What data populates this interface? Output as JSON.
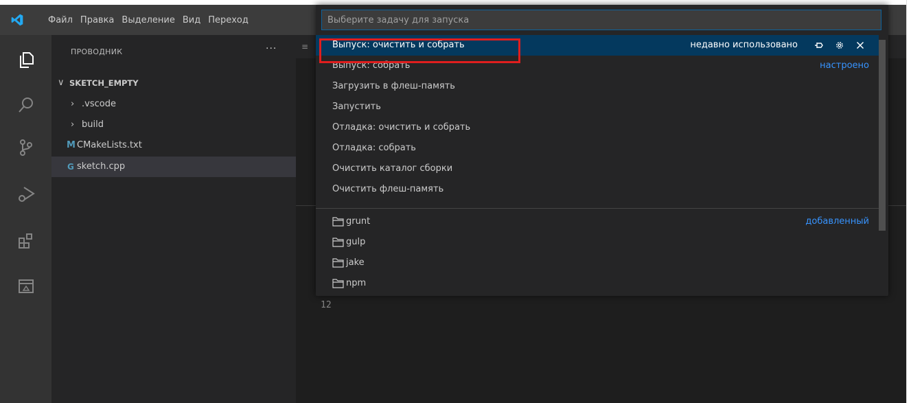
{
  "menu": [
    "Файл",
    "Правка",
    "Выделение",
    "Вид",
    "Переход"
  ],
  "explorer": {
    "title": "ПРОВОДНИК",
    "more": "···",
    "folder": "SKETCH_EMPTY",
    "items": [
      {
        "label": ".vscode",
        "kind": "folder"
      },
      {
        "label": "build",
        "kind": "folder"
      },
      {
        "label": "CMakeLists.txt",
        "kind": "cmake",
        "icon": "M"
      },
      {
        "label": "sketch.cpp",
        "kind": "cpp",
        "icon": "G"
      }
    ]
  },
  "editor": {
    "line_number": "12"
  },
  "quick_pick": {
    "placeholder": "Выберите задачу для запуска",
    "value": "",
    "recent_tag": "недавно использовано",
    "configured_tag": "настроено",
    "added_tag": "добавленный",
    "tasks": [
      "Выпуск: очистить и собрать",
      "Выпуск: собрать",
      "Загрузить в флеш-память",
      "Запустить",
      "Отладка: очистить и собрать",
      "Отладка: собрать",
      "Очистить каталог сборки",
      "Очистить флеш-память"
    ],
    "providers": [
      "grunt",
      "gulp",
      "jake",
      "npm"
    ]
  },
  "colors": {
    "accent": "#0e639c",
    "active_item": "#04395e",
    "highlight": "#e01e1e",
    "tag": "#3794ff"
  }
}
